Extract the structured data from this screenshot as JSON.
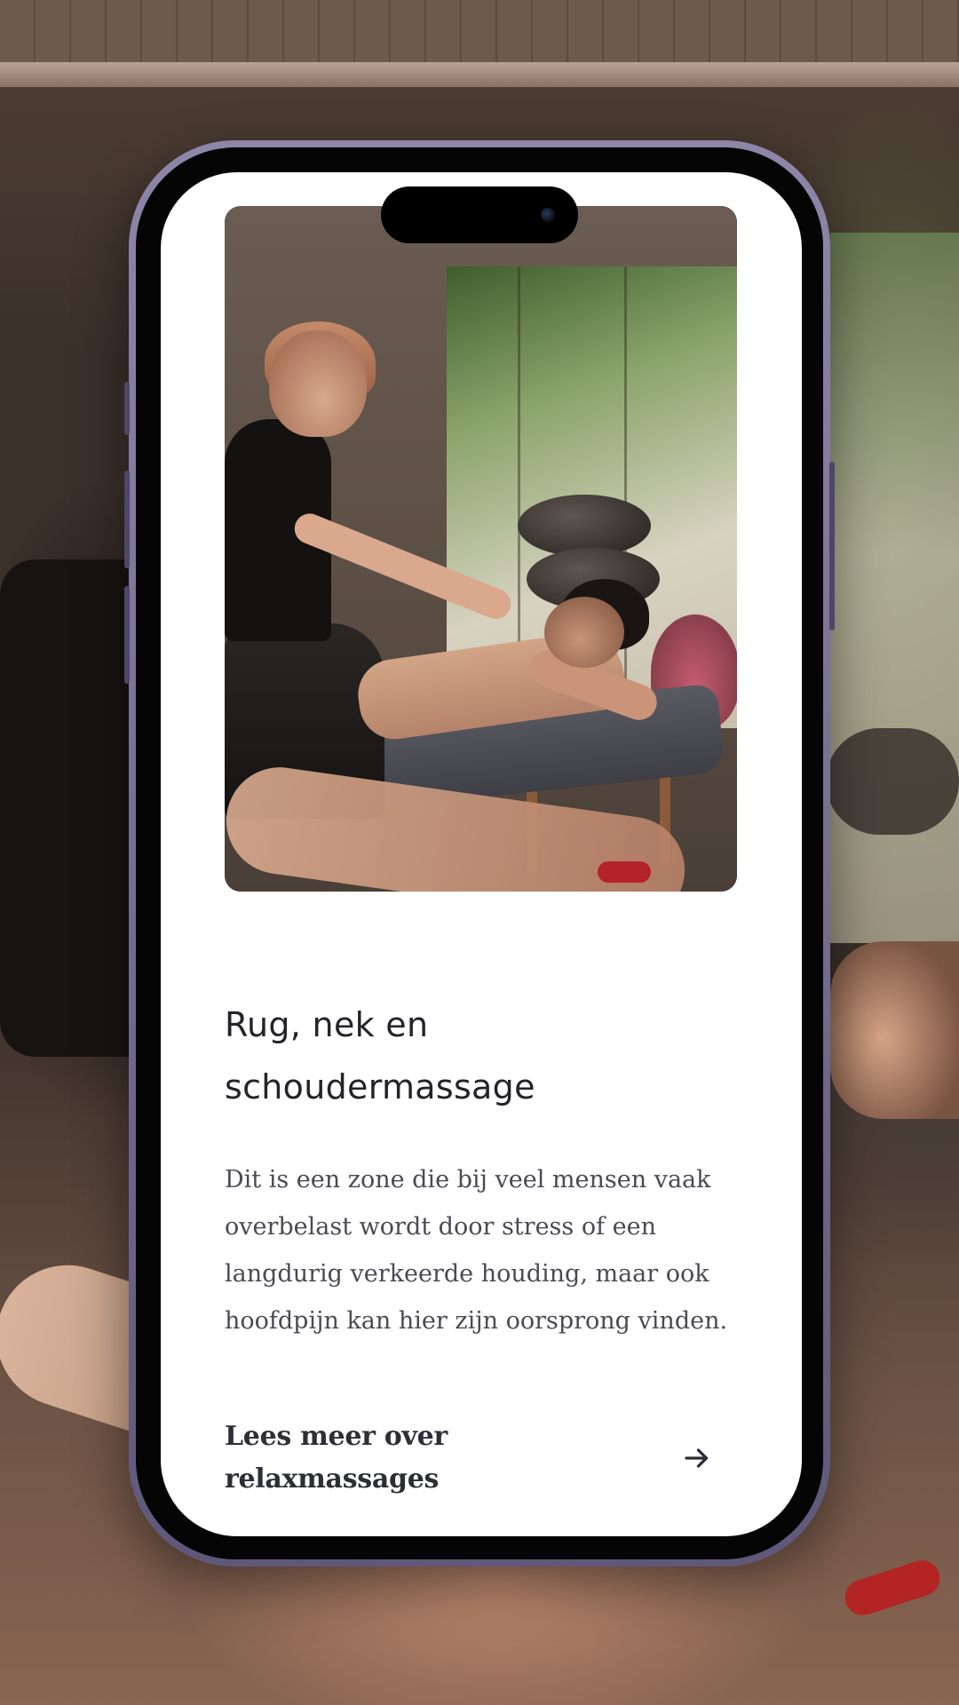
{
  "card": {
    "title": "Rug, nek en schoudermassage",
    "description": "Dit is een zone die bij veel mensen vaak overbelast wordt door stress of een langdurig verkeerde houding, maar ook hoofdpijn kan hier zijn oorsprong vinden.",
    "link_label": "Lees meer over relaxmassages",
    "link_icon": "arrow-right-icon"
  },
  "colors": {
    "title": "#23232b",
    "body": "#4a4a55",
    "phone_frame": "#7a7296"
  }
}
